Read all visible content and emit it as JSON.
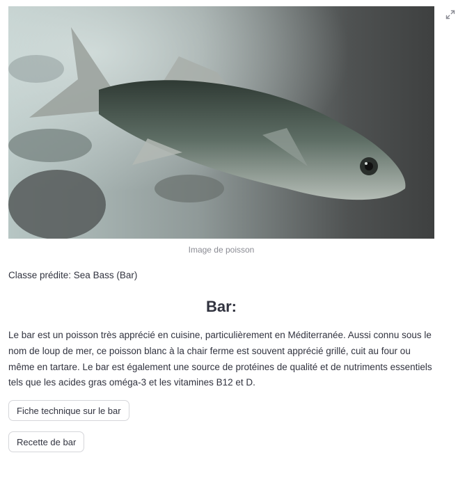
{
  "image": {
    "alt": "Image de poisson",
    "caption": "Image de poisson"
  },
  "prediction": {
    "text": "Classe prédite: Sea Bass (Bar)"
  },
  "section": {
    "title": "Bar:",
    "description": "Le bar est un poisson très apprécié en cuisine, particulièrement en Méditerranée. Aussi connu sous le nom de loup de mer, ce poisson blanc à la chair ferme est souvent apprécié grillé, cuit au four ou même en tartare. Le bar est également une source de protéines de qualité et de nutriments essentiels tels que les acides gras oméga-3 et les vitamines B12 et D."
  },
  "buttons": {
    "tech_sheet": "Fiche technique sur le bar",
    "recipe": "Recette de bar"
  },
  "icons": {
    "expand": "fullscreen-expand-icon"
  }
}
